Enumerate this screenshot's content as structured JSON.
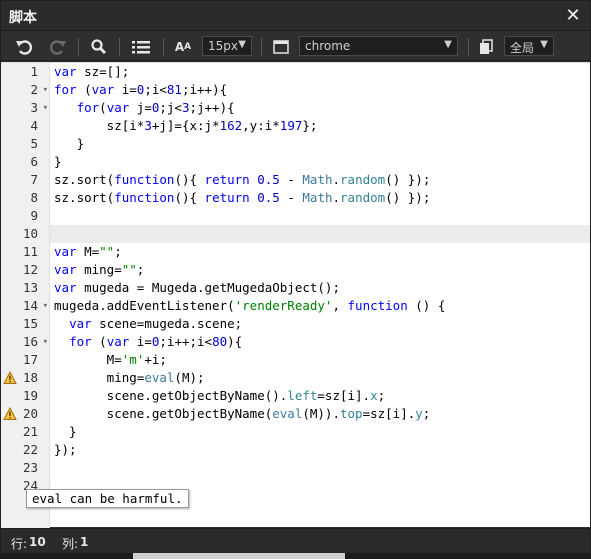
{
  "window": {
    "title": "脚本"
  },
  "toolbar": {
    "font_size": "15px",
    "theme": "chrome",
    "fullscreen_label": "全局"
  },
  "status": {
    "row_label": "行:",
    "row_value": "10",
    "col_label": "列:",
    "col_value": "1"
  },
  "tooltip": {
    "text": "eval can be harmful."
  },
  "editor": {
    "lines": [
      {
        "n": "1",
        "text": "var sz=[];"
      },
      {
        "n": "2",
        "text": "for (var i=0;i<81;i++){",
        "fold": true
      },
      {
        "n": "3",
        "text": "   for(var j=0;j<3;j++){",
        "fold": true
      },
      {
        "n": "4",
        "text": "       sz[i*3+j]={x:j*162,y:i*197};"
      },
      {
        "n": "5",
        "text": "   }"
      },
      {
        "n": "6",
        "text": "}"
      },
      {
        "n": "7",
        "text": "sz.sort(function(){ return 0.5 - Math.random() });"
      },
      {
        "n": "8",
        "text": "sz.sort(function(){ return 0.5 - Math.random() });"
      },
      {
        "n": "9",
        "text": ""
      },
      {
        "n": "10",
        "text": "",
        "active": true
      },
      {
        "n": "11",
        "text": "var M=\"\";"
      },
      {
        "n": "12",
        "text": "var ming=\"\";"
      },
      {
        "n": "13",
        "text": "var mugeda = Mugeda.getMugedaObject();"
      },
      {
        "n": "14",
        "text": "mugeda.addEventListener('renderReady', function () {",
        "fold": true
      },
      {
        "n": "15",
        "text": "  var scene=mugeda.scene;"
      },
      {
        "n": "16",
        "text": "  for (var i=0;i++;i<80){",
        "fold": true
      },
      {
        "n": "17",
        "text": "       M='m'+i;"
      },
      {
        "n": "18",
        "text": "       ming=eval(M);",
        "warn": true
      },
      {
        "n": "19",
        "text": "       scene.getObjectByName().left=sz[i].x;"
      },
      {
        "n": "20",
        "text": "       scene.getObjectByName(eval(M)).top=sz[i].y;",
        "warn": true
      },
      {
        "n": "21",
        "text": "  }"
      },
      {
        "n": "22",
        "text": "});"
      },
      {
        "n": "23",
        "text": ""
      },
      {
        "n": "24",
        "text": ""
      }
    ]
  }
}
